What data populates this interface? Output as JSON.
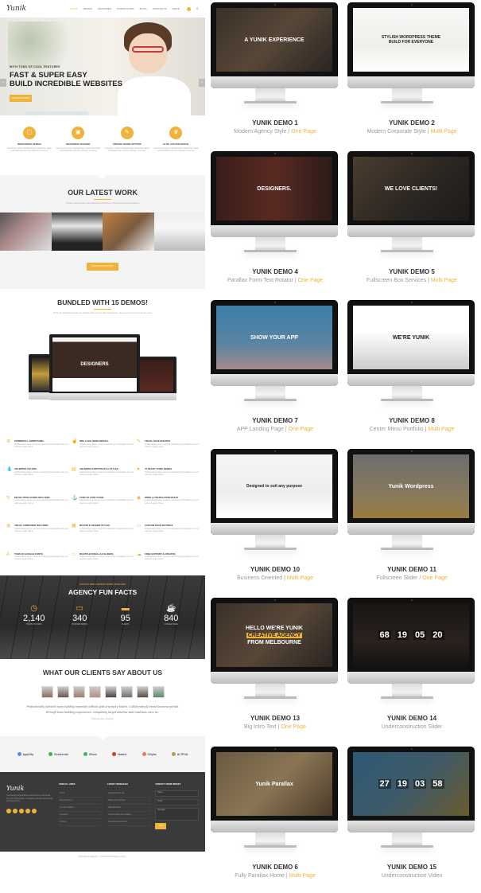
{
  "colors": {
    "accent": "#f0b33a",
    "dark": "#3a3a3a"
  },
  "nav": {
    "logo": "Yunik",
    "items": [
      "Home",
      "Pages",
      "Features",
      "Portfolios",
      "Blog",
      "Contacts",
      "Shop"
    ],
    "active": "Home",
    "icons": [
      "cart-icon",
      "search-icon"
    ]
  },
  "hero": {
    "subtitle": "WITH TONS OF COOL FEATURES",
    "title_line1": "FAST & SUPER EASY",
    "title_line2": "BUILD INCREDIBLE WEBSITES",
    "button": "SEE FEATURES",
    "prev_arrow": "‹",
    "next_arrow": "›"
  },
  "features": [
    {
      "icon": "▢",
      "title": "RESPONSIVE DESIGN",
      "desc": "Assertively create multidisciplinary intellectual capital enthusiastically optimize visionary resources"
    },
    {
      "icon": "▣",
      "title": "DRAG/DROP BUILDER",
      "desc": "Assertively create multidisciplinary intellectual capital enthusiastically optimize visionary resources"
    },
    {
      "icon": "✎",
      "title": "STRONG THEME OPTIONS",
      "desc": "Assertively create multidisciplinary intellectual capital enthusiastically optimize visionary resources"
    },
    {
      "icon": "♛",
      "title": "ELITE AUTHOR DESIGN",
      "desc": "Assertively create multidisciplinary intellectual capital enthusiastically optimize visionary resources"
    }
  ],
  "latest_work": {
    "title": "OUR LATEST WORK",
    "desc": "Uniquely administrate multimedia based action items through professional initiatives",
    "button": "VIEW OUR PORTFOLIO"
  },
  "bundled": {
    "title": "BUNDLED WITH 15 DEMOS!",
    "desc": "All the 15 predefined layouts are available with just one click install theme. Choose your demo and You are done",
    "preview_title": "DESIGNERS"
  },
  "feature_grid": [
    {
      "icon": "⚙",
      "title": "POWERFULL ADMIN PANEL",
      "desc": "Collaboratively deliver resource maximizing functionalities vis-a-vis real-time supply chains."
    },
    {
      "icon": "☝",
      "title": "ONE CLICK DEMO INSTALL",
      "desc": "Collaboratively deliver resource maximizing functionalities vis-a-vis real-time supply chains."
    },
    {
      "icon": "✎",
      "title": "VISUAL PAGE BUILDER",
      "desc": "Collaboratively deliver resource maximizing functionalities vis-a-vis real-time supply chains."
    },
    {
      "icon": "💧",
      "title": "UNLIMITED COLORS",
      "desc": "Collaboratively deliver resource maximizing functionalities vis-a-vis real-time supply chains."
    },
    {
      "icon": "▤",
      "title": "UNLIMITED PORTFOLIOS & STYLES",
      "desc": "Collaboratively deliver resource maximizing functionalities vis-a-vis real-time supply chains."
    },
    {
      "icon": "♥",
      "title": "15 READY YUNIK DEMOS",
      "desc": "Collaboratively deliver resource maximizing functionalities vis-a-vis real-time supply chains."
    },
    {
      "icon": "↻",
      "title": "REVOLUTION SLIDER INCLUDED",
      "desc": "Collaboratively deliver resource maximizing functionalities vis-a-vis real-time supply chains."
    },
    {
      "icon": "⚓",
      "title": "TONS OF FONT ICONS",
      "desc": "Collaboratively deliver resource maximizing functionalities vis-a-vis real-time supply chains."
    },
    {
      "icon": "◉",
      "title": "WPML & TRANSLATION READY",
      "desc": "Collaboratively deliver resource maximizing functionalities vis-a-vis real-time supply chains."
    },
    {
      "icon": "◍",
      "title": "VISUAL COMPOSER INCLUDED",
      "desc": "Collaboratively deliver resource maximizing functionalities vis-a-vis real-time supply chains."
    },
    {
      "icon": "▦",
      "title": "MULTIPLE HEADER STYLES",
      "desc": "Collaboratively deliver resource maximizing functionalities vis-a-vis real-time supply chains."
    },
    {
      "icon": "▭",
      "title": "CUSTOM PAGE SETTINGS",
      "desc": "Collaboratively deliver resource maximizing functionalities vis-a-vis real-time supply chains."
    },
    {
      "icon": "A",
      "title": "TONS OF GOOGLE FONTS",
      "desc": "Collaboratively deliver resource maximizing functionalities vis-a-vis real-time supply chains."
    },
    {
      "icon": "▭",
      "title": "MULTIPLE PARALLAX SLIDERS",
      "desc": "Collaboratively deliver resource maximizing functionalities vis-a-vis real-time supply chains."
    },
    {
      "icon": "☁",
      "title": "FREE SUPPORT & UPDATES",
      "desc": "Collaboratively deliver resource maximizing functionalities vis-a-vis real-time supply chains."
    }
  ],
  "fun_facts": {
    "subtitle": "EXCITING WEB & GRAPHIC WORKS SINCE 2008",
    "title": "AGENCY FUN FACTS",
    "items": [
      {
        "icon": "◷",
        "value": "2,140",
        "label": "HOURS OF WORK"
      },
      {
        "icon": "▭",
        "value": "340",
        "label": "FINISHED WORKS"
      },
      {
        "icon": "▬",
        "value": "95",
        "label": "CLIENTS"
      },
      {
        "icon": "☕",
        "value": "840",
        "label": "COFFEE TAKEN"
      }
    ]
  },
  "clients": {
    "title": "WHAT OUR CLIENTS SAY ABOUT US",
    "avatar_count": 8,
    "quote": "Professionally network team building materials without goal oriented e-tailers. Collaboratively brand business portals through team building experiences. Completely target intuitive web-readiness via a viz.",
    "author": "Paula Morrison / Designer"
  },
  "partners": [
    {
      "name": "AppCity",
      "color": "#5b8def"
    },
    {
      "name": "Ecotrends",
      "color": "#4caf50"
    },
    {
      "name": "Zilent",
      "color": "#3fb56b"
    },
    {
      "name": "Vaatier",
      "color": "#d23a2e"
    },
    {
      "name": "Cityba",
      "color": "#f07a5a"
    },
    {
      "name": "ALTEVA",
      "color": "#b89a55"
    }
  ],
  "footer": {
    "logo": "Yunik",
    "about": "Competently target backend value before cross-media process improvements. Completely cultivate low-risk high-yield systems for",
    "socials": [
      "facebook-icon",
      "twitter-icon",
      "google-icon",
      "dribbble-icon",
      "linkedin-icon"
    ],
    "useful_links": {
      "title": "USEFULL LINKS",
      "items": [
        "Home",
        "About Version 1",
        "Services Version 2",
        "Contacts 2",
        "Portfolio"
      ]
    },
    "blog": {
      "title": "LATEST FROM BLOG",
      "items": [
        "Looking into the sea",
        "Waiting for Christmas",
        "White Mountain",
        "Proportionally build visualize",
        "Sound-track Audio Post"
      ]
    },
    "contact": {
      "title": "CONTACT FROM WIDGET",
      "name_placeholder": "Name",
      "email_placeholder": "Email",
      "message_placeholder": "Message",
      "send": "Send"
    },
    "copyright": "Build with by Designed. © 2015 Yunik Wordpress Theme"
  },
  "demos": [
    {
      "name": "YUNIK DEMO 1",
      "desc": "Modern Agency Style",
      "sep": " / ",
      "tag": "One Page",
      "screen": "A YUNIK EXPERIENCE",
      "bg": "linear-gradient(135deg,#3b3027,#574738 50%,#2a2420)"
    },
    {
      "name": "YUNIK DEMO 2",
      "desc": "Modern Corporate Style",
      "sep": " | ",
      "tag": "Multi Page",
      "screen": "STYLISH WORDPRESS THEME BUILD FOR EVERYONE",
      "bg": "linear-gradient(180deg,#f7f7f7,#f0efea 60%,#fff)"
    },
    {
      "name": "YUNIK DEMO 4",
      "desc": "Parallax Form Text Rotator",
      "sep": "  | ",
      "tag": "One Page",
      "screen": "DESIGNERS.",
      "bg": "linear-gradient(90deg,#3a1e1a,#5a2a22 50%,#2b1b18)"
    },
    {
      "name": "YUNIK DEMO 5",
      "desc": "Fullscreen Box Services",
      "sep": " | ",
      "tag": "Multi Page",
      "screen": "WE LOVE CLIENTS!",
      "bg": "linear-gradient(135deg,#4a3d30,#2a2520 60%,#1e1b18)"
    },
    {
      "name": "YUNIK DEMO 7",
      "desc": "APP Landing Page",
      "sep": " | ",
      "tag": "One Page",
      "screen": "SHOW YOUR APP",
      "bg": "linear-gradient(180deg,#3f7ea8,#5a85a3 60%,#a88a8a)"
    },
    {
      "name": "YUNIK DEMO 8",
      "desc": "Center Menu Portfolio",
      "sep": " | ",
      "tag": "Multi Page",
      "screen": "WE'RE YUNIK",
      "bg": "linear-gradient(180deg,#fff 40%,#ccc)"
    },
    {
      "name": "YUNIK DEMO 10",
      "desc": "Business Oriented",
      "sep": " | ",
      "tag": "Multi Page",
      "screen": "Designed to suit any purpose",
      "bg": "linear-gradient(180deg,#f5f5f5,#eee 60%,#fff)"
    },
    {
      "name": "YUNIK DEMO 11",
      "desc": "Fullscreen Slider",
      "sep": " / ",
      "tag": "One Page",
      "screen": "Yunik Wordpress",
      "bg": "linear-gradient(180deg,#6d6d6d,#8a7a5a 70%,#9c7b3c)"
    },
    {
      "name": "YUNIK DEMO 13",
      "desc": "Big Intro Text",
      "sep": " | ",
      "tag": "One Page",
      "screen": "HELLO WE'RE YUNIK|CREATIVE AGENCY|FROM MELBOURNE",
      "bg": "linear-gradient(135deg,#3b3027,#574738 50%,#2a2420)"
    },
    {
      "name": "YUNIK DEMO 14",
      "desc": "Underconstruction Slider",
      "sep": "",
      "tag": "",
      "screen": "68|19|05|20",
      "bg": "linear-gradient(180deg,#1a1614,#2a221d 60%,#151210)"
    },
    {
      "name": "YUNIK DEMO 6",
      "desc": "Fully Parallax Home",
      "sep": " | ",
      "tag": "Multi Page",
      "screen": "Yunik Parallax",
      "bg": "linear-gradient(135deg,#6b5a40,#8a7555 50%,#4a3a28)"
    },
    {
      "name": "YUNIK DEMO 15",
      "desc": "Underconstruction Video",
      "sep": "",
      "tag": "",
      "screen": "27|19|03|58",
      "bg": "linear-gradient(135deg,#2e5a75,#3d5a68 50%,#6b5a30)"
    }
  ]
}
